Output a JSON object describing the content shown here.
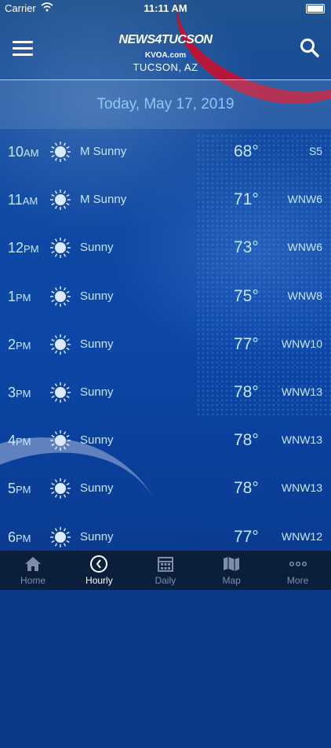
{
  "status": {
    "carrier": "Carrier",
    "time": "11:11 AM"
  },
  "header": {
    "logo_line1": "NEWS4TUCSON",
    "logo_line2": "KVOA.com",
    "location": "TUCSON, AZ"
  },
  "date": "Today, May 17, 2019",
  "hours": [
    {
      "hour": "10",
      "ampm": "AM",
      "icon": "sun-icon",
      "condition": "M Sunny",
      "temp": "68°",
      "wind": "S5"
    },
    {
      "hour": "11",
      "ampm": "AM",
      "icon": "sun-icon",
      "condition": "M Sunny",
      "temp": "71°",
      "wind": "WNW6"
    },
    {
      "hour": "12",
      "ampm": "PM",
      "icon": "sun-icon",
      "condition": "Sunny",
      "temp": "73°",
      "wind": "WNW6"
    },
    {
      "hour": "1",
      "ampm": "PM",
      "icon": "sun-icon",
      "condition": "Sunny",
      "temp": "75°",
      "wind": "WNW8"
    },
    {
      "hour": "2",
      "ampm": "PM",
      "icon": "sun-icon",
      "condition": "Sunny",
      "temp": "77°",
      "wind": "WNW10"
    },
    {
      "hour": "3",
      "ampm": "PM",
      "icon": "sun-icon",
      "condition": "Sunny",
      "temp": "78°",
      "wind": "WNW13"
    },
    {
      "hour": "4",
      "ampm": "PM",
      "icon": "sun-icon",
      "condition": "Sunny",
      "temp": "78°",
      "wind": "WNW13"
    },
    {
      "hour": "5",
      "ampm": "PM",
      "icon": "sun-icon",
      "condition": "Sunny",
      "temp": "78°",
      "wind": "WNW13"
    },
    {
      "hour": "6",
      "ampm": "PM",
      "icon": "sun-icon",
      "condition": "Sunny",
      "temp": "77°",
      "wind": "WNW12"
    }
  ],
  "tabs": [
    {
      "label": "Home",
      "icon": "home-icon",
      "active": false
    },
    {
      "label": "Hourly",
      "icon": "clock-icon",
      "active": true
    },
    {
      "label": "Daily",
      "icon": "calendar-icon",
      "active": false
    },
    {
      "label": "Map",
      "icon": "map-icon",
      "active": false
    },
    {
      "label": "More",
      "icon": "more-icon",
      "active": false
    }
  ],
  "colors": {
    "accent": "#c8102e",
    "text": "#c7e6ff",
    "date": "#8cc8f5",
    "tabbar": "#0b1f3c"
  }
}
